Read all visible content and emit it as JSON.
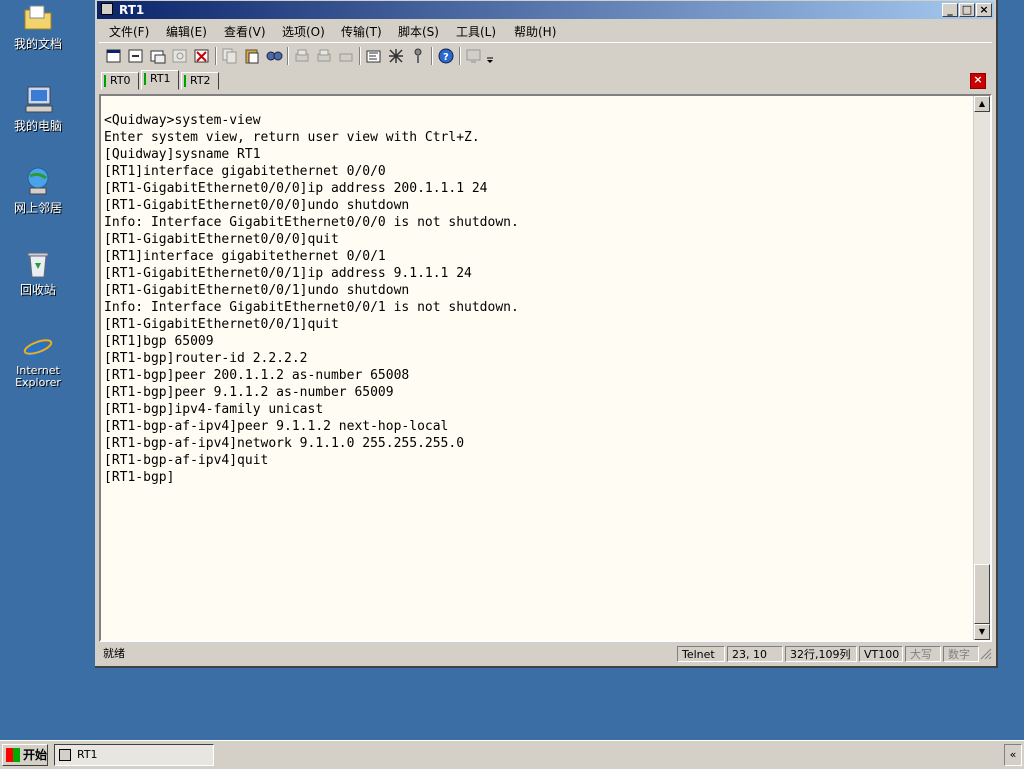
{
  "desktop": {
    "icons": [
      {
        "label": "我的文档",
        "icon": "my-documents-icon"
      },
      {
        "label": "我的电脑",
        "icon": "my-computer-icon"
      },
      {
        "label": "网上邻居",
        "icon": "network-places-icon"
      },
      {
        "label": "回收站",
        "icon": "recycle-bin-icon"
      },
      {
        "label": "Internet Explorer",
        "icon": "internet-explorer-icon"
      }
    ]
  },
  "window": {
    "title": "RT1",
    "controls": {
      "minimize": "_",
      "maximize": "□",
      "close": "×"
    }
  },
  "menu": {
    "items": [
      "文件(F)",
      "编辑(E)",
      "查看(V)",
      "选项(O)",
      "传输(T)",
      "脚本(S)",
      "工具(L)",
      "帮助(H)"
    ]
  },
  "toolbar": {
    "buttons": [
      "new-session-icon",
      "connect-icon",
      "quick-connect-icon",
      "reconnect-icon",
      "disconnect-icon",
      "copy-icon",
      "paste-icon",
      "find-icon",
      "print-icon",
      "print-setup-icon",
      "print-selection-icon",
      "session-options-icon",
      "global-options-icon",
      "keymap-icon",
      "help-icon",
      "screen-icon",
      "more-icon"
    ]
  },
  "tabs": {
    "items": [
      "RT0",
      "RT1",
      "RT2"
    ],
    "active": "RT1"
  },
  "terminal": {
    "lines": [
      "<Quidway>system-view",
      "Enter system view, return user view with Ctrl+Z.",
      "[Quidway]sysname RT1",
      "[RT1]interface gigabitethernet 0/0/0",
      "[RT1-GigabitEthernet0/0/0]ip address 200.1.1.1 24",
      "[RT1-GigabitEthernet0/0/0]undo shutdown",
      "Info: Interface GigabitEthernet0/0/0 is not shutdown.",
      "[RT1-GigabitEthernet0/0/0]quit",
      "[RT1]interface gigabitethernet 0/0/1",
      "[RT1-GigabitEthernet0/0/1]ip address 9.1.1.1 24",
      "[RT1-GigabitEthernet0/0/1]undo shutdown",
      "Info: Interface GigabitEthernet0/0/1 is not shutdown.",
      "[RT1-GigabitEthernet0/0/1]quit",
      "[RT1]bgp 65009",
      "[RT1-bgp]router-id 2.2.2.2",
      "[RT1-bgp]peer 200.1.1.2 as-number 65008",
      "[RT1-bgp]peer 9.1.1.2 as-number 65009",
      "[RT1-bgp]ipv4-family unicast",
      "[RT1-bgp-af-ipv4]peer 9.1.1.2 next-hop-local",
      "[RT1-bgp-af-ipv4]network 9.1.1.0 255.255.255.0",
      "[RT1-bgp-af-ipv4]quit",
      "[RT1-bgp]"
    ]
  },
  "status": {
    "ready": "就绪",
    "protocol": "Telnet",
    "cursor": "23,  10",
    "size": "32行,109列",
    "emulation": "VT100",
    "caps": "大写",
    "num": "数字"
  },
  "taskbar": {
    "start_label": "开始",
    "task_label": "RT1",
    "tray_label": "«"
  },
  "colors": {
    "desktop": "#3a6ea5",
    "titlebar_start": "#0a246a",
    "terminal_bg": "#fffdf3",
    "tab_active_mark": "#00a000"
  }
}
